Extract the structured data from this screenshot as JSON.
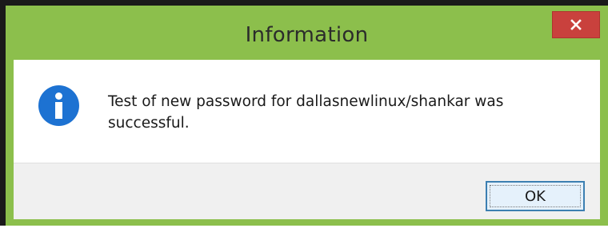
{
  "dialog": {
    "title": "Information",
    "close_icon": "close-icon",
    "message_icon": "info-icon",
    "message": "Test of new password for dallasnewlinux/shankar was successful.",
    "ok_label": "OK"
  },
  "colors": {
    "frame": "#8cbf4c",
    "close_button": "#c9413d",
    "info_icon": "#1d72d2",
    "button_border": "#3c7fb1"
  }
}
